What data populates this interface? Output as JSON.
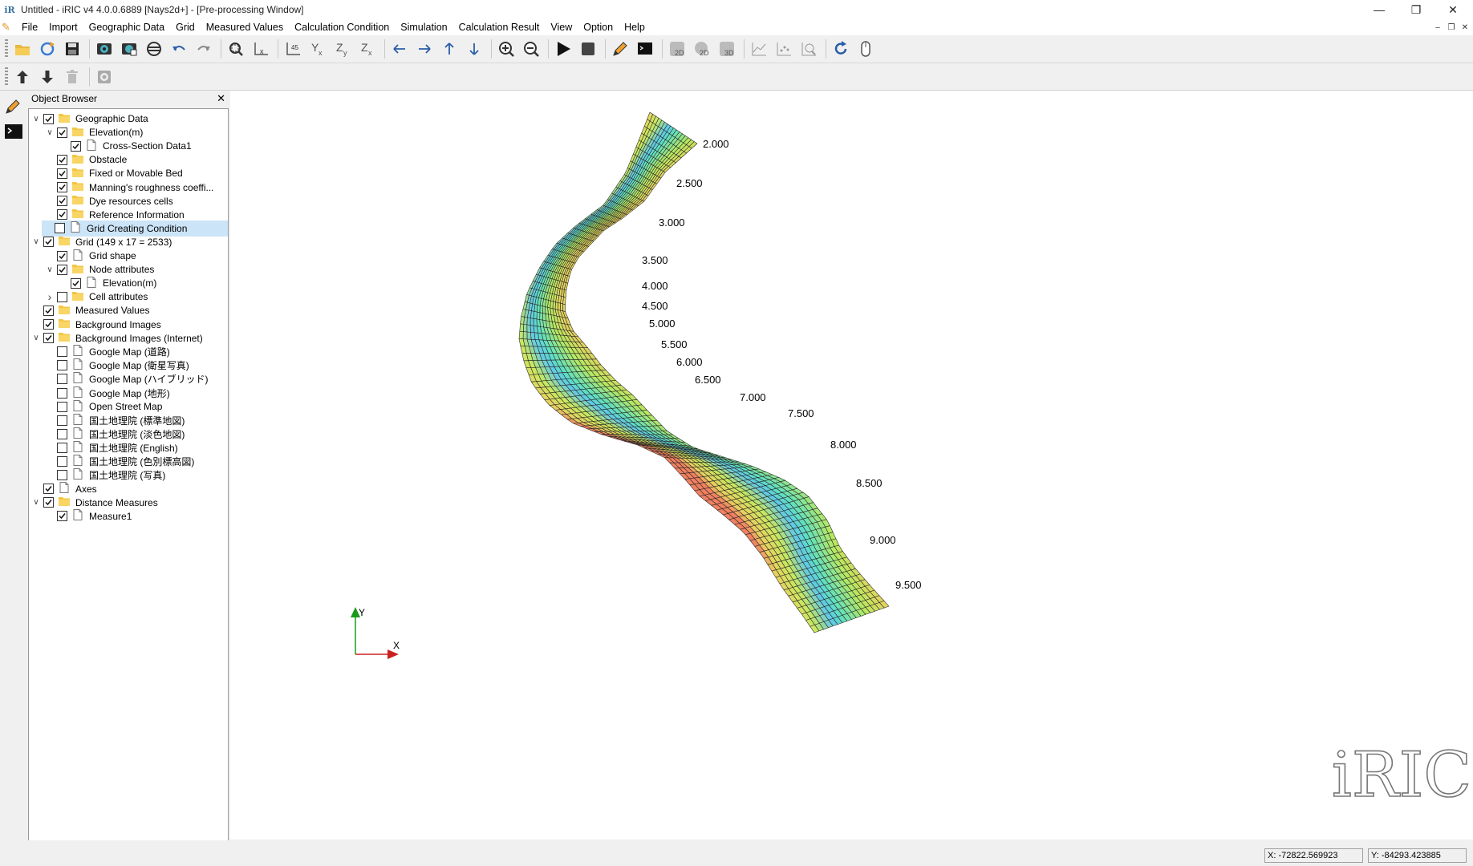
{
  "window": {
    "title": "Untitled - iRIC v4 4.0.0.6889 [Nays2d+] - [Pre-processing Window]"
  },
  "menu": [
    "File",
    "Import",
    "Geographic Data",
    "Grid",
    "Measured Values",
    "Calculation Condition",
    "Simulation",
    "Calculation Result",
    "View",
    "Option",
    "Help"
  ],
  "toolbar_icons": [
    "open-folder-icon",
    "reload-icon",
    "save-icon",
    "camera-icon",
    "snapshot-icon",
    "no-entry-icon",
    "undo-icon",
    "redo-icon",
    "zoom-fit-icon",
    "scale-x-icon",
    "scale-xy-icon",
    "yz-plane-icon",
    "zy-plane-icon",
    "zx-plane-icon",
    "move-left-icon",
    "move-right-icon",
    "move-up-icon",
    "move-down-icon",
    "zoom-in-icon",
    "zoom-out-icon",
    "run-icon",
    "stop-icon",
    "edit-pen-icon",
    "console-icon",
    "2d-icon",
    "2d-alt-icon",
    "3d-icon",
    "graph-icon",
    "scatter-icon",
    "zoom-box-icon",
    "refresh-icon",
    "mouse-icon"
  ],
  "object_browser": {
    "title": "Object Browser",
    "items": [
      {
        "label": "Geographic Data",
        "level": 0,
        "expander": "open",
        "checked": true,
        "icon": "folder"
      },
      {
        "label": "Elevation(m)",
        "level": 1,
        "expander": "open",
        "checked": true,
        "icon": "folder"
      },
      {
        "label": "Cross-Section Data1",
        "level": 2,
        "expander": "none",
        "checked": true,
        "icon": "doc"
      },
      {
        "label": "Obstacle",
        "level": 1,
        "expander": "none",
        "checked": true,
        "icon": "folder"
      },
      {
        "label": "Fixed or Movable Bed",
        "level": 1,
        "expander": "none",
        "checked": true,
        "icon": "folder"
      },
      {
        "label": "Manning's roughness coeffi...",
        "level": 1,
        "expander": "none",
        "checked": true,
        "icon": "folder"
      },
      {
        "label": "Dye resources cells",
        "level": 1,
        "expander": "none",
        "checked": true,
        "icon": "folder"
      },
      {
        "label": "Reference Information",
        "level": 1,
        "expander": "none",
        "checked": true,
        "icon": "folder"
      },
      {
        "label": "Grid Creating Condition",
        "level": 0,
        "expander": "none",
        "checked": false,
        "icon": "doc",
        "selected": true
      },
      {
        "label": "Grid (149 x 17 = 2533)",
        "level": 0,
        "expander": "open",
        "checked": true,
        "icon": "folder"
      },
      {
        "label": "Grid shape",
        "level": 1,
        "expander": "none",
        "checked": true,
        "icon": "doc"
      },
      {
        "label": "Node attributes",
        "level": 1,
        "expander": "open",
        "checked": true,
        "icon": "folder"
      },
      {
        "label": "Elevation(m)",
        "level": 2,
        "expander": "none",
        "checked": true,
        "icon": "doc"
      },
      {
        "label": "Cell attributes",
        "level": 1,
        "expander": "closed",
        "checked": false,
        "icon": "folder"
      },
      {
        "label": "Measured Values",
        "level": 0,
        "expander": "none",
        "checked": true,
        "icon": "folder"
      },
      {
        "label": "Background Images",
        "level": 0,
        "expander": "none",
        "checked": true,
        "icon": "folder"
      },
      {
        "label": "Background Images (Internet)",
        "level": 0,
        "expander": "open",
        "checked": true,
        "icon": "folder"
      },
      {
        "label": "Google Map (道路)",
        "level": 1,
        "expander": "none",
        "checked": false,
        "icon": "doc"
      },
      {
        "label": "Google Map (衛星写真)",
        "level": 1,
        "expander": "none",
        "checked": false,
        "icon": "doc"
      },
      {
        "label": "Google Map (ハイブリッド)",
        "level": 1,
        "expander": "none",
        "checked": false,
        "icon": "doc"
      },
      {
        "label": "Google Map (地形)",
        "level": 1,
        "expander": "none",
        "checked": false,
        "icon": "doc"
      },
      {
        "label": "Open Street Map",
        "level": 1,
        "expander": "none",
        "checked": false,
        "icon": "doc"
      },
      {
        "label": "国土地理院 (標準地図)",
        "level": 1,
        "expander": "none",
        "checked": false,
        "icon": "doc"
      },
      {
        "label": "国土地理院 (淡色地図)",
        "level": 1,
        "expander": "none",
        "checked": false,
        "icon": "doc"
      },
      {
        "label": "国土地理院 (English)",
        "level": 1,
        "expander": "none",
        "checked": false,
        "icon": "doc"
      },
      {
        "label": "国土地理院 (色別標高図)",
        "level": 1,
        "expander": "none",
        "checked": false,
        "icon": "doc"
      },
      {
        "label": "国土地理院 (写真)",
        "level": 1,
        "expander": "none",
        "checked": false,
        "icon": "doc"
      },
      {
        "label": "Axes",
        "level": 0,
        "expander": "none",
        "checked": true,
        "icon": "doc"
      },
      {
        "label": "Distance Measures",
        "level": 0,
        "expander": "open",
        "checked": true,
        "icon": "folder"
      },
      {
        "label": "Measure1",
        "level": 1,
        "expander": "none",
        "checked": true,
        "icon": "doc"
      }
    ]
  },
  "viewport": {
    "distance_labels": [
      "2.000",
      "2.500",
      "3.000",
      "3.500",
      "4.000",
      "4.500",
      "5.000",
      "5.500",
      "6.000",
      "6.500",
      "7.000",
      "7.500",
      "8.000",
      "8.500",
      "9.000",
      "9.500"
    ],
    "axis_x_label": "X",
    "axis_y_label": "Y",
    "logo_text": "iRIC"
  },
  "status": {
    "x": "X: -72822.569923",
    "y": "Y: -84293.423885"
  }
}
